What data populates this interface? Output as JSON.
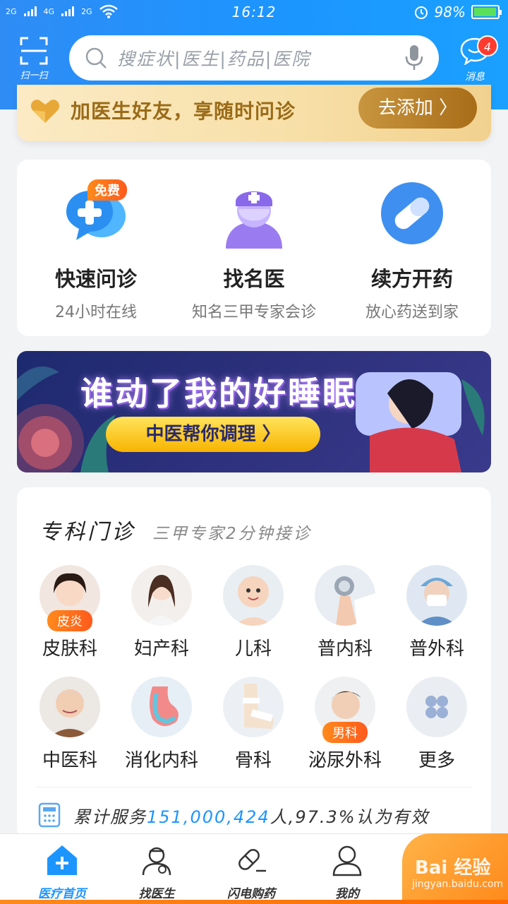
{
  "status_bar": {
    "time": "16:12",
    "battery": "98%",
    "battery_level": 0.98,
    "signal_1": "2G",
    "signal_2": "4G",
    "signal_3": "2G"
  },
  "header": {
    "scan_label": "扫一扫",
    "search_placeholder": "搜症状|医生|药品|医院",
    "message_label": "消息",
    "message_count": "4"
  },
  "friend_banner": {
    "text": "加医生好友，享随时问诊",
    "button": "去添加 〉"
  },
  "services": [
    {
      "title": "快速问诊",
      "subtitle": "24小时在线",
      "badge": "免费",
      "icon": "consult-chat-icon"
    },
    {
      "title": "找名医",
      "subtitle": "知名三甲专家会诊",
      "icon": "nurse-doctor-icon"
    },
    {
      "title": "续方开药",
      "subtitle": "放心药送到家",
      "icon": "pill-icon"
    }
  ],
  "sleep_banner": {
    "title": "谁动了我的好睡眠",
    "button": "中医帮你调理 〉"
  },
  "specialty": {
    "title": "专科门诊",
    "subtitle": "三甲专家2分钟接诊",
    "departments": [
      {
        "label": "皮肤科",
        "tag": "皮炎"
      },
      {
        "label": "妇产科"
      },
      {
        "label": "儿科"
      },
      {
        "label": "普内科"
      },
      {
        "label": "普外科"
      },
      {
        "label": "中医科"
      },
      {
        "label": "消化内科"
      },
      {
        "label": "骨科"
      },
      {
        "label": "泌尿外科",
        "tag": "男科"
      },
      {
        "label": "更多"
      }
    ],
    "stats_prefix": "累计服务",
    "stats_number": "151,000,424",
    "stats_suffix": "人,97.3%认为有效"
  },
  "tabbar": {
    "tabs": [
      {
        "label": "医疗首页",
        "active": true
      },
      {
        "label": "找医生"
      },
      {
        "label": "闪电购药"
      },
      {
        "label": "我的"
      }
    ],
    "watermark": "Bai 经验",
    "watermark_sub": "jingyan.baidu.com"
  },
  "colors": {
    "brand_blue": "#1c95ff",
    "accent_orange": "#ff7a1c",
    "gold": "#b07a25"
  }
}
